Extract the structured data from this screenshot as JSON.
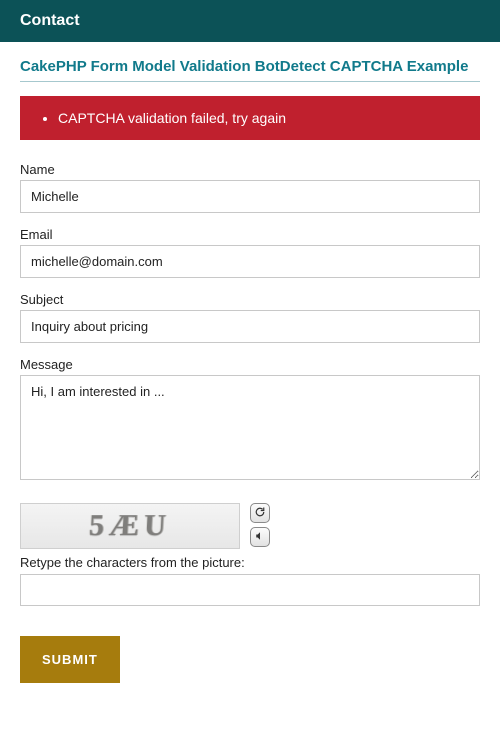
{
  "header": {
    "title": "Contact"
  },
  "page": {
    "title": "CakePHP Form Model Validation BotDetect CAPTCHA Example"
  },
  "errors": {
    "items": [
      {
        "text": "CAPTCHA validation failed, try again"
      }
    ]
  },
  "form": {
    "name": {
      "label": "Name",
      "value": "Michelle"
    },
    "email": {
      "label": "Email",
      "value": "michelle@domain.com"
    },
    "subject": {
      "label": "Subject",
      "value": "Inquiry about pricing"
    },
    "message": {
      "label": "Message",
      "value": "Hi, I am interested in ..."
    },
    "captcha": {
      "display_text": "5ÆU",
      "retype_label": "Retype the characters from the picture:",
      "value": ""
    },
    "submit_label": "SUBMIT"
  }
}
